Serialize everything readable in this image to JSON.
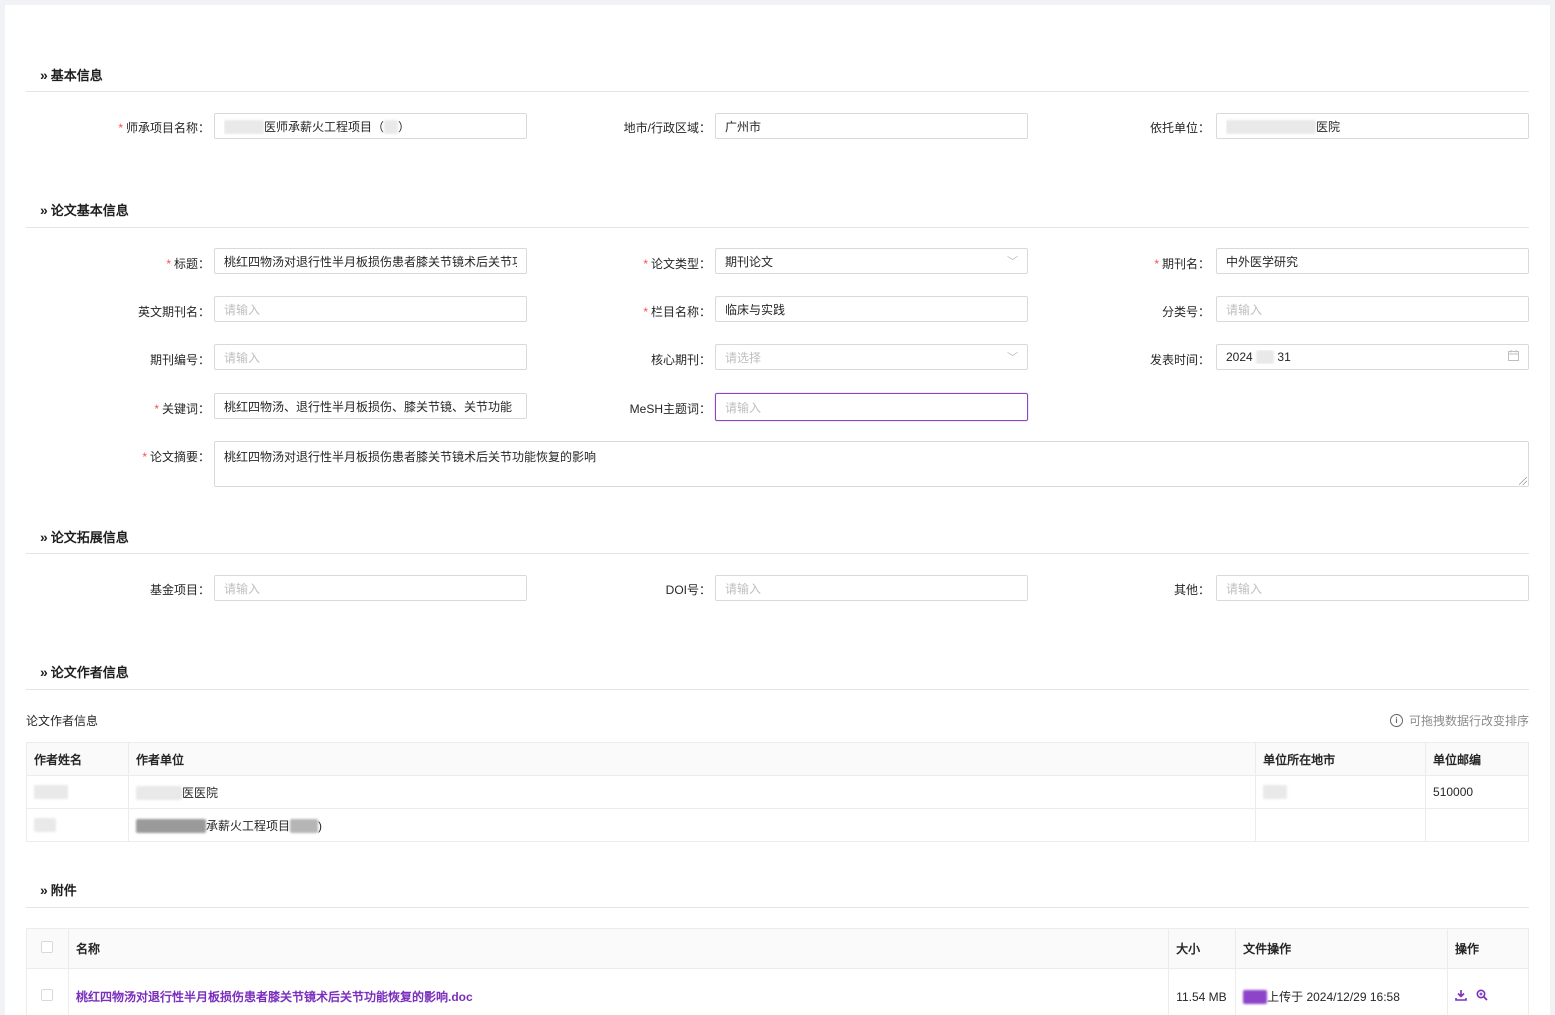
{
  "sections": {
    "basic": "基本信息",
    "paper_basic": "论文基本信息",
    "paper_ext": "论文拓展信息",
    "authors": "论文作者信息",
    "attachments": "附件"
  },
  "basic": {
    "project_label": "师承项目名称：",
    "project_value": "医师承薪火工程项目（",
    "project_value_tail": "）",
    "region_label": "地市/行政区域：",
    "region_value": "广州市",
    "unit_label": "依托单位：",
    "unit_value_tail": "医院"
  },
  "paper": {
    "title_label": "标题：",
    "title_value": "桃红四物汤对退行性半月板损伤患者膝关节镜术后关节功能恢复的影响",
    "type_label": "论文类型：",
    "type_value": "期刊论文",
    "journal_label": "期刊名：",
    "journal_value": "中外医学研究",
    "en_journal_label": "英文期刊名：",
    "en_journal_placeholder": "请输入",
    "column_label": "栏目名称：",
    "column_value": "临床与实践",
    "class_label": "分类号：",
    "class_placeholder": "请输入",
    "issue_label": "期刊编号：",
    "issue_placeholder": "请输入",
    "core_label": "核心期刊：",
    "core_placeholder": "请选择",
    "pubdate_label": "发表时间：",
    "pubdate_value_head": "2024",
    "pubdate_value_tail": "31",
    "keywords_label": "关键词：",
    "keywords_value": "桃红四物汤、退行性半月板损伤、膝关节镜、关节功能",
    "mesh_label": "MeSH主题词：",
    "mesh_placeholder": "请输入",
    "abstract_label": "论文摘要：",
    "abstract_value": "桃红四物汤对退行性半月板损伤患者膝关节镜术后关节功能恢复的影响"
  },
  "ext": {
    "fund_label": "基金项目：",
    "fund_placeholder": "请输入",
    "doi_label": "DOI号：",
    "doi_placeholder": "请输入",
    "other_label": "其他：",
    "other_placeholder": "请输入"
  },
  "authors": {
    "table_title": "论文作者信息",
    "hint": "可拖拽数据行改变排序",
    "columns": [
      "作者姓名",
      "作者单位",
      "单位所在地市",
      "单位邮编"
    ],
    "rows": [
      {
        "name": "",
        "unit": "医医院",
        "city": "",
        "zip": "510000"
      },
      {
        "name": "",
        "unit": "承薪火工程项目",
        "unit_tail": ")",
        "city": "",
        "zip": ""
      }
    ]
  },
  "attachments": {
    "columns": [
      "名称",
      "大小",
      "文件操作",
      "操作"
    ],
    "rows": [
      {
        "name": "桃红四物汤对退行性半月板损伤患者膝关节镜术后关节功能恢复的影响.doc",
        "size": "11.54 MB",
        "upload": "上传于 2024/12/29 16:58"
      }
    ]
  },
  "icons": {
    "section": "double-chevron-right-icon",
    "select": "chevron-down-icon",
    "date": "calendar-icon",
    "info": "info-icon",
    "download": "download-icon",
    "preview": "zoom-in-icon"
  },
  "colors": {
    "accent": "#7b2fbe",
    "required": "#ff4d4f"
  }
}
